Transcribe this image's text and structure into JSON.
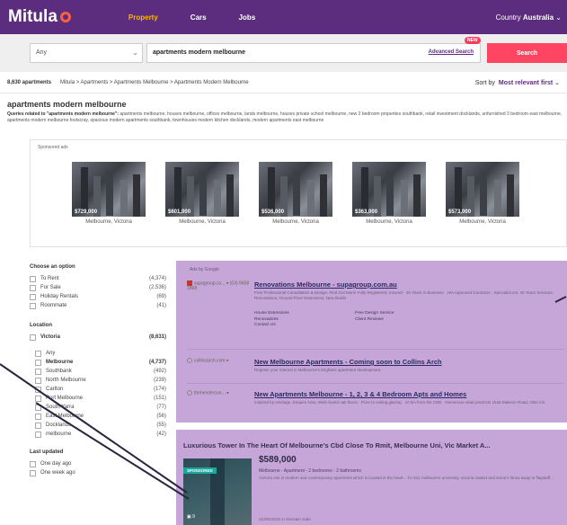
{
  "header": {
    "logo": "Mitula",
    "nav": [
      "Property",
      "Cars",
      "Jobs"
    ],
    "country_label": "Country",
    "country_value": "Australia"
  },
  "search": {
    "type_value": "Any",
    "query": "apartments modern melbourne",
    "advanced_label": "Advanced Search",
    "new_badge": "NEW",
    "button_label": "Search"
  },
  "breadcrumb": {
    "count": "8,630 apartments",
    "path": "Mitula  >  Apartments  >  Apartments Melbourne  >  Apartments Modern Melbourne",
    "sort_label": "Sort by",
    "sort_value": "Most relevant first"
  },
  "page": {
    "title": "apartments modern melbourne",
    "related_prefix": "Queries related to \"apartments modern melbourne\":",
    "related_text": " apartments melbourne, houses melbourne, offices melbourne, lands melbourne, houses private school melbourne, new 2 bedroom properties southbank, retail investment docklands, unfurnished 3 bedroom east melbourne, apartments modern melbourne footscray, spacious modern apartments southbank, townhouses modern kitchen docklands, modern apartments east melbourne"
  },
  "sponsored": {
    "label": "Sponsored ads",
    "cards": [
      {
        "price": "$729,000",
        "location": "Melbourne, Victoria"
      },
      {
        "price": "$601,000",
        "location": "Melbourne, Victoria"
      },
      {
        "price": "$536,000",
        "location": "Melbourne, Victoria"
      },
      {
        "price": "$363,000",
        "location": "Melbourne, Victoria"
      },
      {
        "price": "$573,000",
        "location": "Melbourne, Victoria"
      }
    ]
  },
  "filters": {
    "option_title": "Choose an option",
    "options": [
      {
        "label": "To Rent",
        "count": "(4,374)"
      },
      {
        "label": "For Sale",
        "count": "(2,536)"
      },
      {
        "label": "Holiday Rentals",
        "count": "(69)"
      },
      {
        "label": "Roommate",
        "count": "(41)"
      }
    ],
    "location_title": "Location",
    "location_root": {
      "label": "Victoria",
      "count": "(8,631)"
    },
    "locations": [
      {
        "label": "Any",
        "count": ""
      },
      {
        "label": "Melbourne",
        "count": "(4,737)"
      },
      {
        "label": "Southbank",
        "count": "(492)"
      },
      {
        "label": "North Melbourne",
        "count": "(239)"
      },
      {
        "label": "Carlton",
        "count": "(174)"
      },
      {
        "label": "Port Melbourne",
        "count": "(151)"
      },
      {
        "label": "South Yarra",
        "count": "(77)"
      },
      {
        "label": "East Melbourne",
        "count": "(56)"
      },
      {
        "label": "Docklands",
        "count": "(55)"
      },
      {
        "label": "melbourne",
        "count": "(42)"
      }
    ],
    "updated_title": "Last updated",
    "updated": [
      "One day ago",
      "One week ago"
    ]
  },
  "ads": {
    "label": "Ads by Google",
    "items": [
      {
        "source": "supagroup.co... ▾ (03) 9458 1868",
        "title": "Renovations Melbourne - supagroup.com.au",
        "desc": "Free Professional Consultation & Design. Find Out More! Fully Registered, Insured · 40 Years in Business · HIA Approved Contracts · Specialist est. 40 Years Services: Renovations, Ground Floor Extensions, New Builds",
        "sitelinks": [
          "House Extensions",
          "Free Design Service",
          "Renovations",
          "Client Reviews",
          "Contact Us",
          ""
        ]
      },
      {
        "source": "collinsarch.com ▾",
        "title": "New Melbourne Apartments - Coming soon to Collins Arch",
        "desc": "Register your interest in Melbourne's brightest apartment development."
      },
      {
        "source": "thehenderson... ▾",
        "title": "New Apartments Melbourne - 1, 2, 3 & 4 Bedroom Apts and Homes",
        "desc": "Inspired by Heritage. Enquire Now. Wide-board oak floors · Floor to ceiling glazing · 10 km from the CBD · Numerous retail precincts 1645 Malvern Road, Glen Iris"
      }
    ]
  },
  "listing": {
    "title": "Luxurious Tower In The Heart Of Melbourne's Cbd Close To Rmit, Melbourne Uni, Vic Market A...",
    "badge": "SPONSORED",
    "photos": "▣ 9",
    "price": "$589,000",
    "meta": "Melbourne - Apartment - 2 bedrooms - 2 bathrooms",
    "desc": "Victoria one is modern and contemporary apartment which is located in the heart... To mid, melbourne university, victoria market and stone's throw away to flagstaff...",
    "date": "21/06/2016 in Domain Sale"
  },
  "colors": {
    "header": "#5c2d7e",
    "accent": "#ffb400",
    "search_button": "#ff4562",
    "overlay": "#c6a6d8"
  }
}
